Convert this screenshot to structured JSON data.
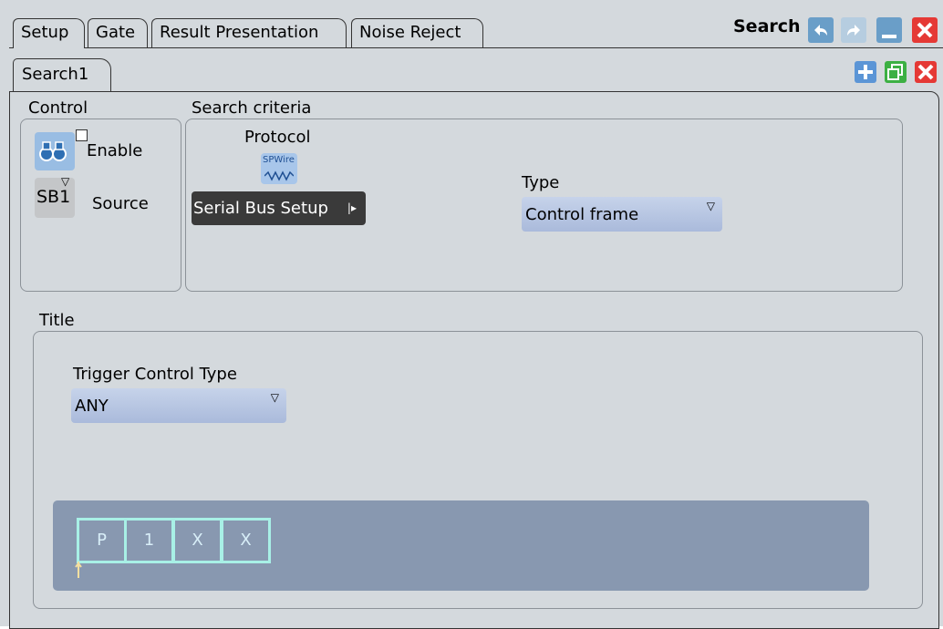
{
  "tabs": [
    {
      "label": "Setup",
      "active": true
    },
    {
      "label": "Gate",
      "active": false
    },
    {
      "label": "Result Presentation",
      "active": false
    },
    {
      "label": "Noise Reject",
      "active": false
    }
  ],
  "window": {
    "title": "Search",
    "buttons": [
      "undo-icon",
      "redo-icon",
      "minimize-icon",
      "close-icon"
    ]
  },
  "subtab": {
    "label": "Search1",
    "actions": [
      "add-icon",
      "copy-icon",
      "delete-icon"
    ]
  },
  "control": {
    "label": "Control",
    "enable_label": "Enable",
    "source_label": "Source",
    "source_value": "SB1",
    "enabled": false
  },
  "criteria": {
    "label": "Search criteria",
    "protocol_label": "Protocol",
    "protocol_icon_text": "SPWire",
    "bus_setup_label": "Serial Bus Setup",
    "type_label": "Type",
    "type_value": "Control frame"
  },
  "title_group": {
    "label": "Title",
    "trigger_control_type_label": "Trigger Control Type",
    "trigger_control_type_value": "ANY",
    "sequence": [
      "P",
      "1",
      "X",
      "X"
    ]
  },
  "colors": {
    "background": "#d4d9dd",
    "accent_blue": "#6a9ec8",
    "dropdown": "#b4c4e2",
    "sequence_panel": "#8898b0",
    "sequence_border": "#a8f0e6",
    "close_red": "#e53935"
  }
}
